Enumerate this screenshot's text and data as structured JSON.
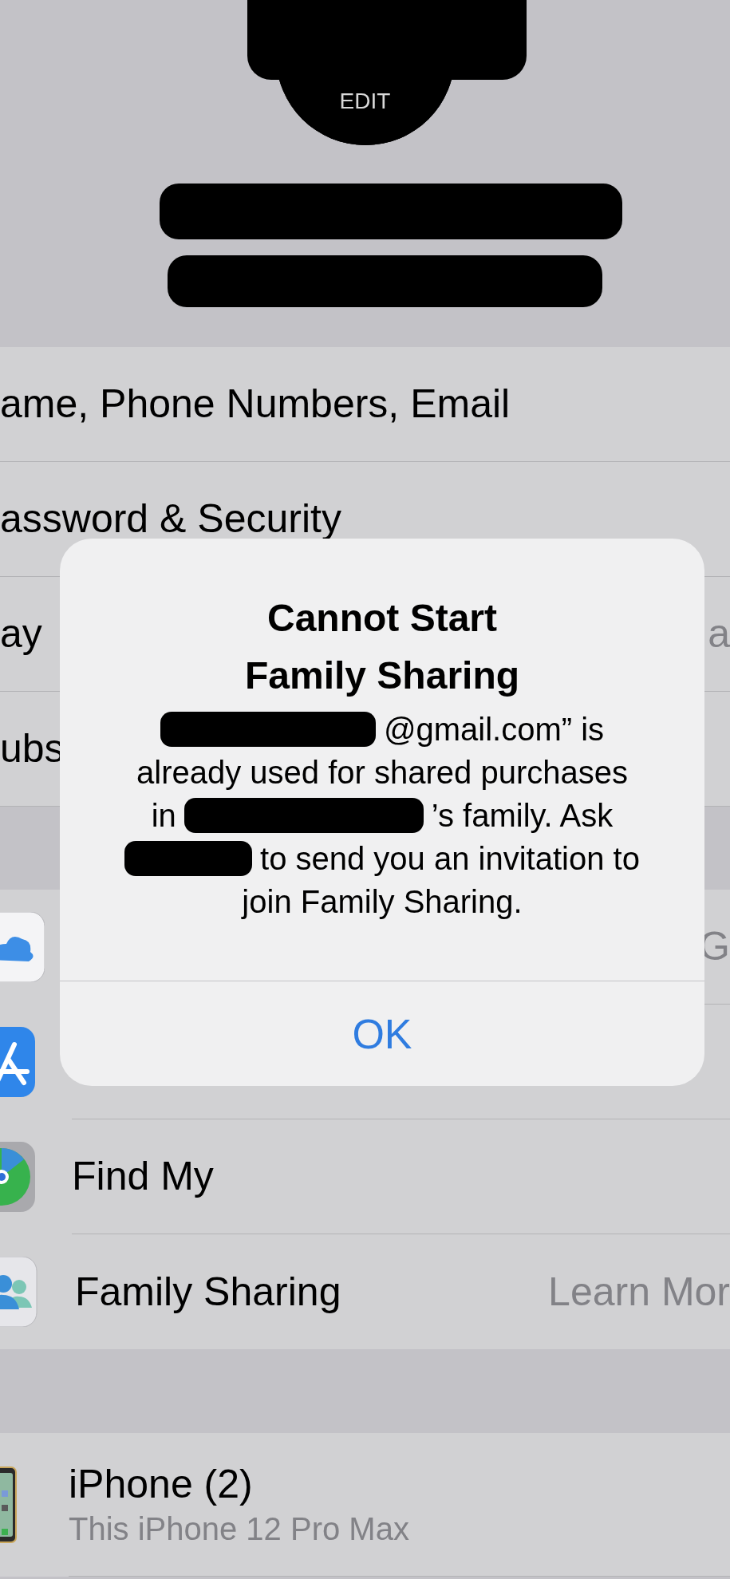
{
  "profile": {
    "edit_label": "EDIT"
  },
  "account_rows": [
    {
      "label": "ame, Phone Numbers, Email"
    },
    {
      "label": "assword & Security"
    },
    {
      "label": "ay",
      "value": "a"
    },
    {
      "label": "ubs"
    }
  ],
  "service_rows": [
    {
      "kind": "cloud",
      "value": "G"
    },
    {
      "kind": "store"
    },
    {
      "kind": "findmy",
      "label": "Find My"
    },
    {
      "kind": "family",
      "label": "Family Sharing",
      "value": "Learn Mor"
    }
  ],
  "device": {
    "name": "iPhone (2)",
    "model": "This iPhone 12 Pro Max"
  },
  "alert": {
    "title": "Cannot Start\nFamily Sharing",
    "message_lines": [
      [
        {
          "kind": "redaction"
        },
        {
          "kind": "text",
          "text": "@gmail.com” is"
        }
      ],
      [
        {
          "kind": "text",
          "text": "already used for shared purchases"
        }
      ],
      [
        {
          "kind": "text",
          "text": "in"
        },
        {
          "kind": "redaction"
        },
        {
          "kind": "text",
          "text": "’s family. Ask"
        }
      ],
      [
        {
          "kind": "redaction"
        },
        {
          "kind": "text",
          "text": "to send you an invitation to"
        }
      ],
      [
        {
          "kind": "text",
          "text": "join Family Sharing."
        }
      ]
    ],
    "button": "OK"
  }
}
